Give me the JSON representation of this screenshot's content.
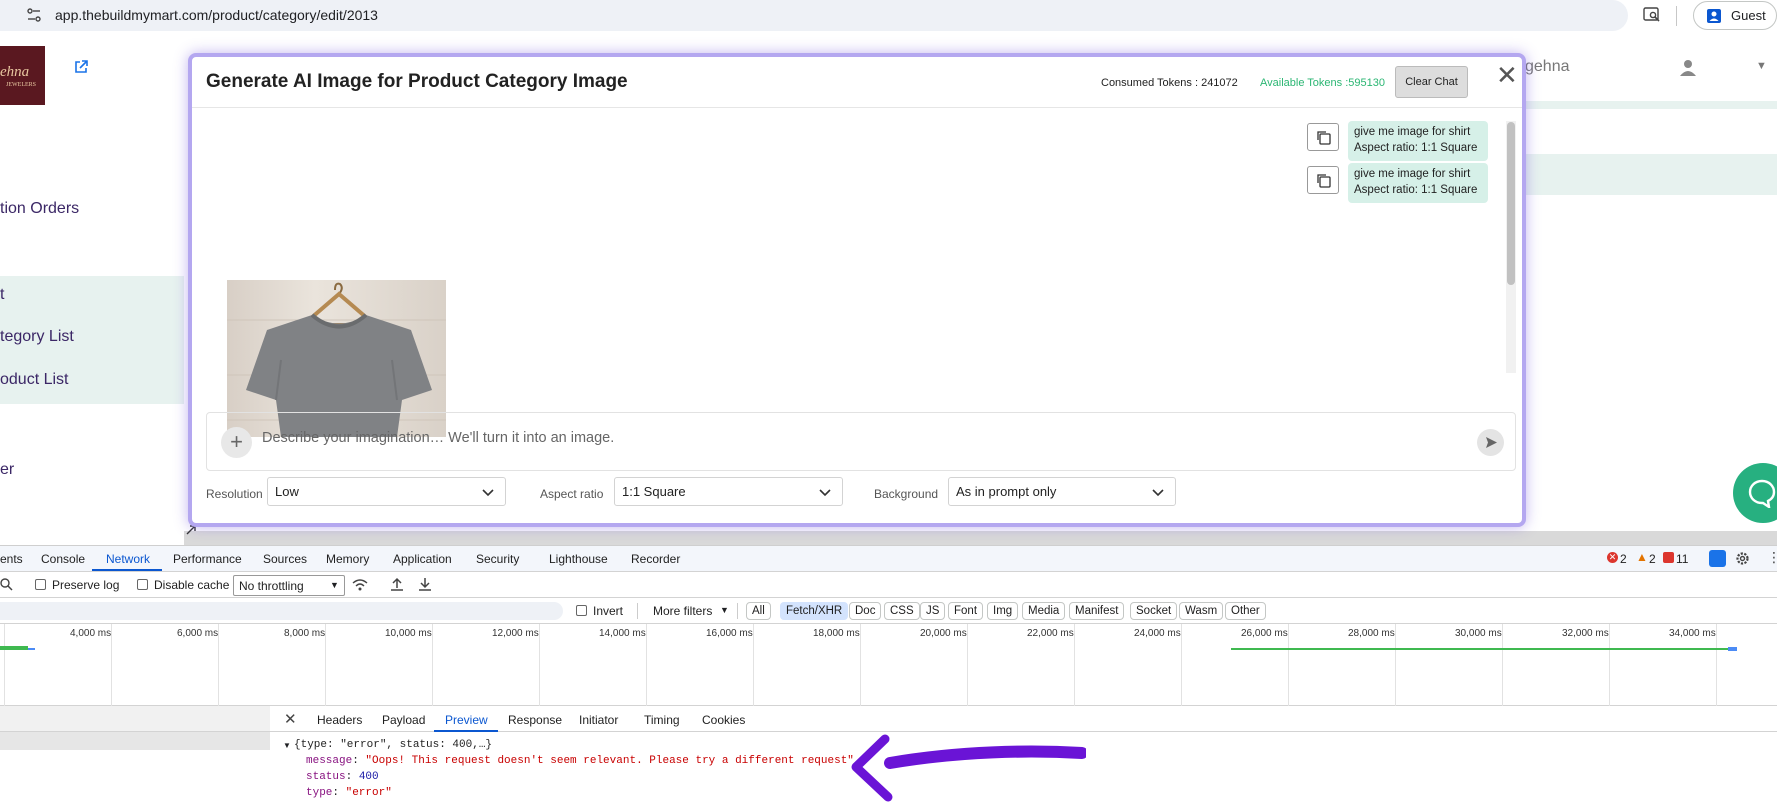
{
  "browser": {
    "url": "app.thebuildmymart.com/product/category/edit/2013",
    "profile_label": "Guest"
  },
  "page": {
    "logo_text": "ehna",
    "logo_subtext": "JEWELERS",
    "sidebar": [
      {
        "label": "tion Orders"
      },
      {
        "label": "t"
      },
      {
        "label": "tegory List"
      },
      {
        "label": "oduct List"
      },
      {
        "label": "er"
      }
    ],
    "user_name": "gehna"
  },
  "modal": {
    "title": "Generate AI Image for Product Category Image",
    "consumed_tokens": "Consumed Tokens : 241072",
    "available_tokens": "Available Tokens :595130",
    "clear_chat_label": "Clear Chat",
    "messages": [
      {
        "line1": "give me image for shirt",
        "line2": "Aspect ratio: 1:1 Square"
      },
      {
        "line1": "give me image for shirt",
        "line2": "Aspect ratio: 1:1 Square"
      }
    ],
    "prompt_placeholder": "Describe your imagination… We'll turn it into an image.",
    "options": {
      "resolution_label": "Resolution",
      "resolution_value": "Low",
      "aspect_label": "Aspect ratio",
      "aspect_value": "1:1 Square",
      "background_label": "Background",
      "background_value": "As in prompt only"
    }
  },
  "devtools": {
    "tabs": [
      "ents",
      "Console",
      "Network",
      "Performance",
      "Sources",
      "Memory",
      "Application",
      "Security",
      "Lighthouse",
      "Recorder"
    ],
    "errors": "2",
    "warnings": "2",
    "issues": "11",
    "toolbar": {
      "preserve_log": "Preserve log",
      "disable_cache": "Disable cache",
      "throttling": "No throttling"
    },
    "filter": {
      "invert": "Invert",
      "more_filters": "More filters",
      "chips": [
        "All",
        "Fetch/XHR",
        "Doc",
        "CSS",
        "JS",
        "Font",
        "Img",
        "Media",
        "Manifest",
        "Socket",
        "Wasm",
        "Other"
      ],
      "active_chip": "Fetch/XHR"
    },
    "timeline_ticks": [
      "4,000 ms",
      "6,000 ms",
      "8,000 ms",
      "10,000 ms",
      "12,000 ms",
      "14,000 ms",
      "16,000 ms",
      "18,000 ms",
      "20,000 ms",
      "22,000 ms",
      "24,000 ms",
      "26,000 ms",
      "28,000 ms",
      "30,000 ms",
      "32,000 ms",
      "34,000 ms"
    ],
    "detail_tabs": [
      "Headers",
      "Payload",
      "Preview",
      "Response",
      "Initiator",
      "Timing",
      "Cookies"
    ],
    "active_detail_tab": "Preview",
    "preview": {
      "summary": "{type: \"error\", status: 400,…}",
      "message_key": "message",
      "message_value": "\"Oops! This request doesn't seem relevant. Please try a different request\"",
      "status_key": "status",
      "status_value": "400",
      "type_key": "type",
      "type_value": "\"error\""
    }
  },
  "colors": {
    "accent_network": "#0b57d0",
    "tokens_green": "#2bb673",
    "annotation_arrow": "#6a14d6",
    "modal_border": "#b4a7f0"
  }
}
